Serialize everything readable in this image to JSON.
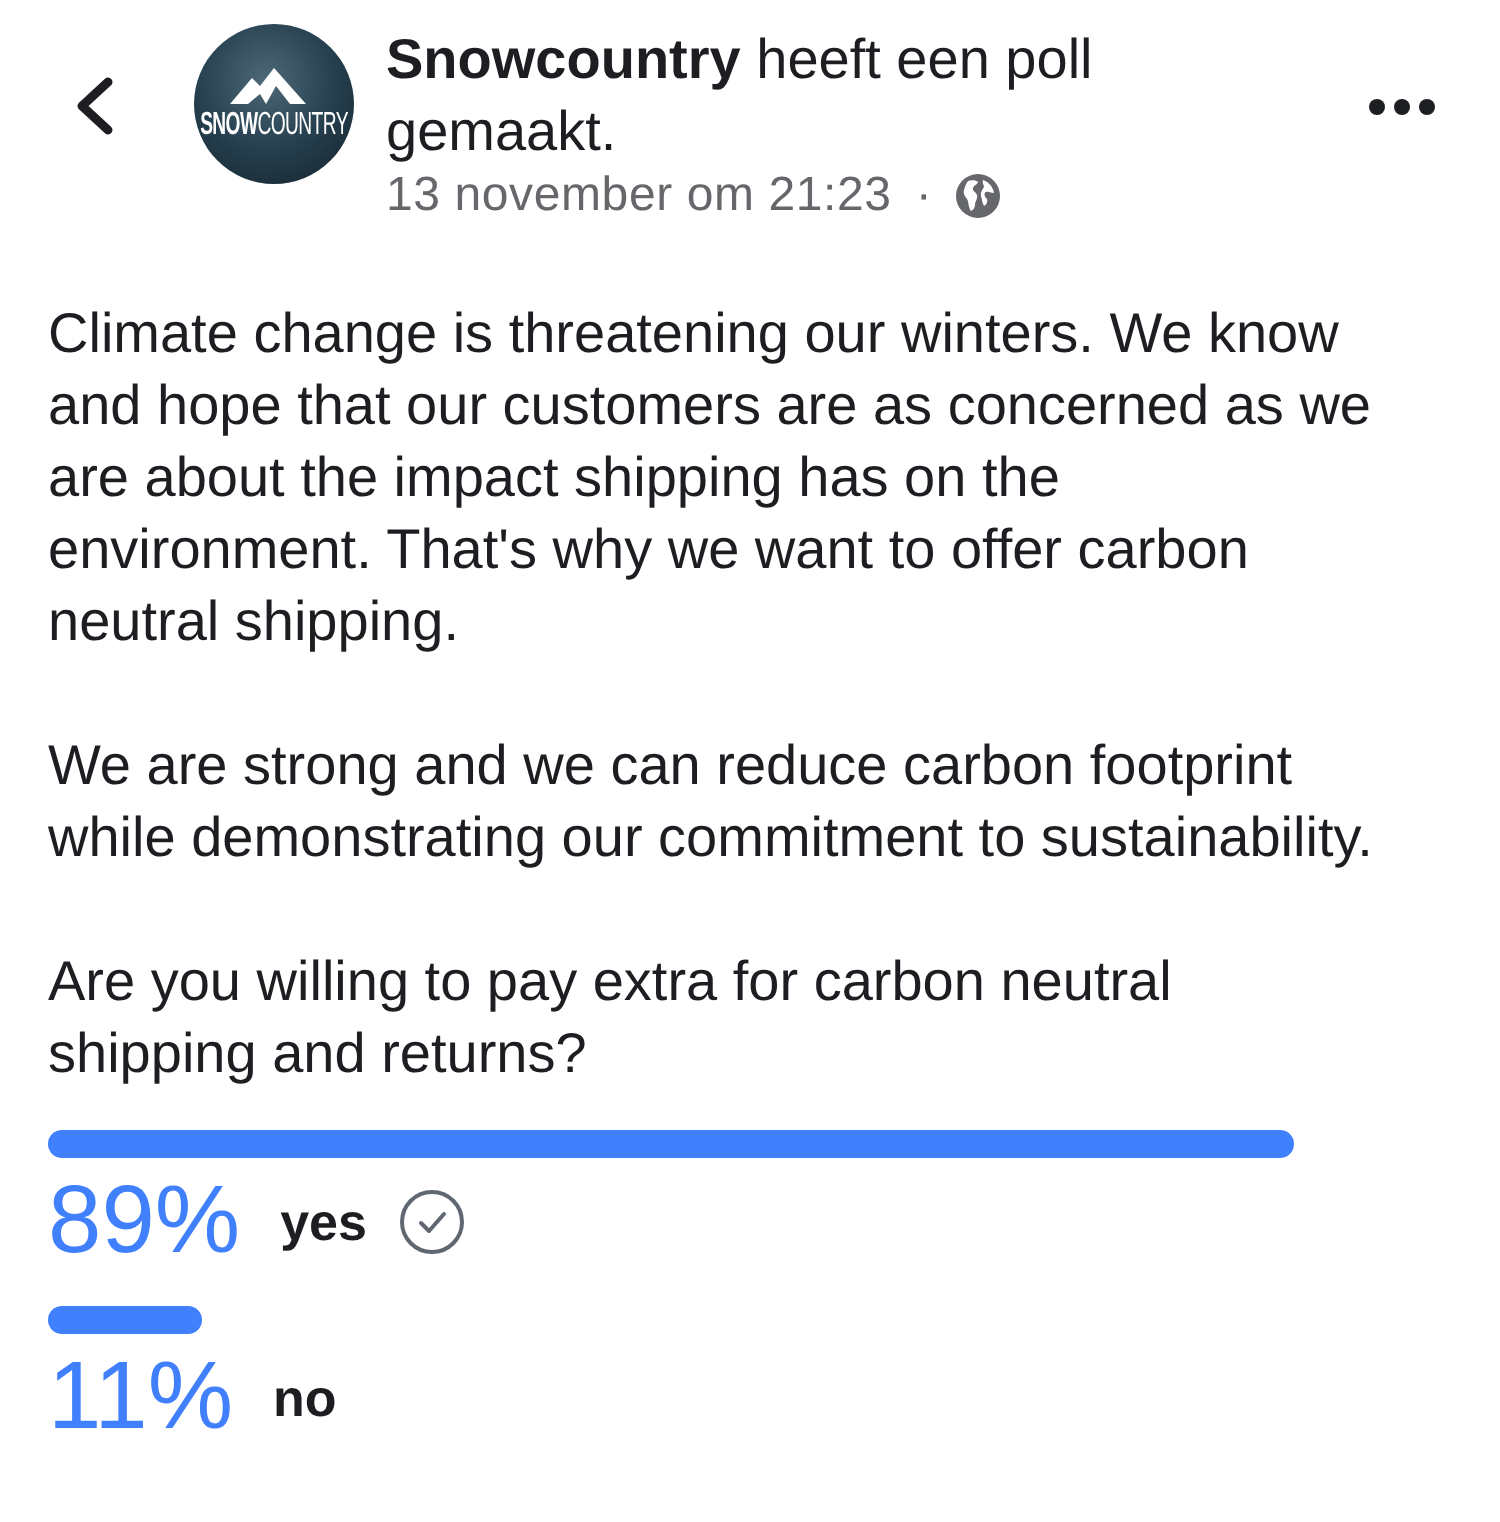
{
  "header": {
    "author": "Snowcountry",
    "action": "heeft een poll gemaakt.",
    "timestamp": "13 november om 21:23",
    "separator": "·",
    "avatar": {
      "logo_text": "**SNOW**COUNTRY"
    }
  },
  "body": {
    "paragraphs": [
      "Climate change is threatening our winters. We know and hope that our customers are as concerned as we are about the impact shipping has on the environment. That's why we want to offer carbon neutral shipping.",
      "We are strong and we can reduce carbon footprint while demonstrating our commitment to sustainability."
    ]
  },
  "poll": {
    "question": "Are you willing to pay extra for carbon neutral shipping and returns?",
    "options": [
      {
        "percent": "89%",
        "label": "yes",
        "level": 0.89,
        "selected": true
      },
      {
        "percent": "11%",
        "label": "no",
        "level": 0.11,
        "selected": false
      }
    ]
  }
}
